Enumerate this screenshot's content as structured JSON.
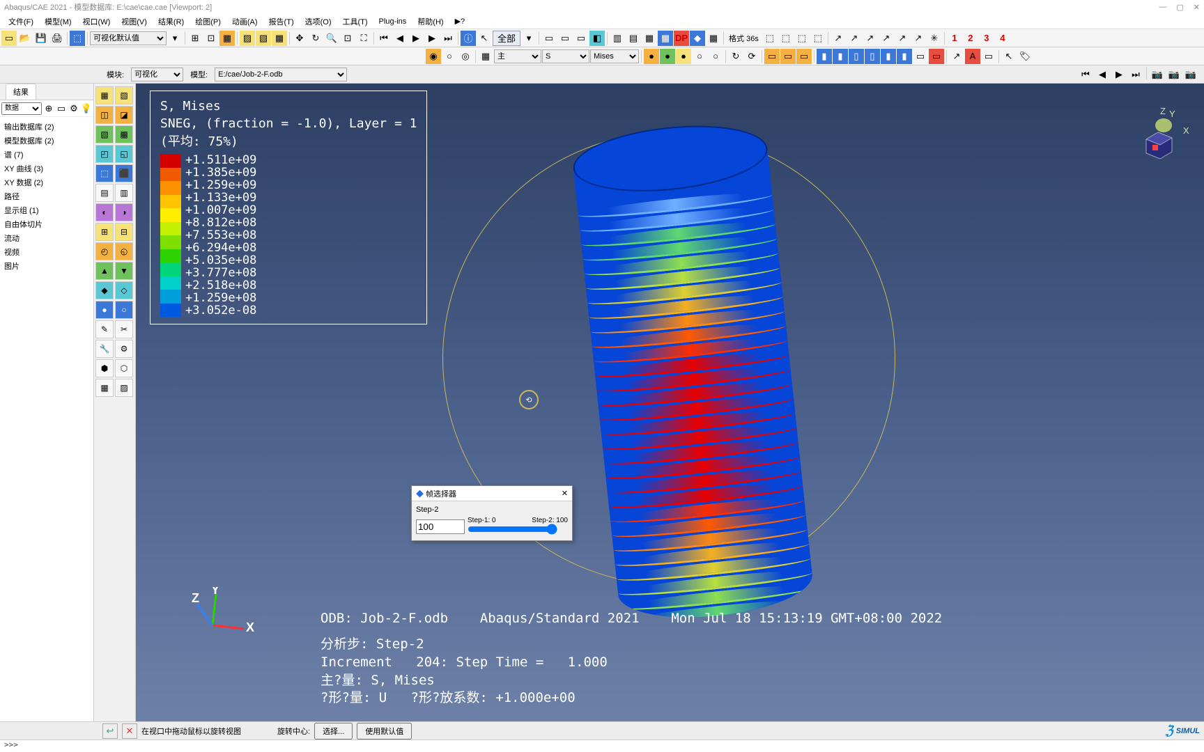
{
  "title": "Abaqus/CAE 2021 - 模型数据库: E:\\cae\\cae.cae [Viewport: 2]",
  "menu": [
    "文件(F)",
    "模型(M)",
    "视口(W)",
    "视图(V)",
    "结果(R)",
    "绘图(P)",
    "动画(A)",
    "报告(T)",
    "选项(O)",
    "工具(T)",
    "Plug-ins",
    "帮助(H)",
    "▶?"
  ],
  "toolbar1": {
    "viz_dropdown": "可视化默认值"
  },
  "toolbar_right": {
    "all_btn": "全部",
    "format_label": "格式  36s",
    "s_dropdown": "S",
    "mises_dropdown": "Mises",
    "primary_dropdown": "主"
  },
  "context": {
    "module_label": "模块:",
    "module_value": "可视化",
    "model_label": "模型:",
    "model_value": "E:/cae/Job-2-F.odb"
  },
  "left_tab": "结果",
  "tree_toolbar": {
    "dropdown": "数据"
  },
  "tree": [
    "输出数据库 (2)",
    "模型数据库 (2)",
    "谱 (7)",
    "XY 曲线 (3)",
    "XY 数据 (2)",
    "路径",
    "显示组 (1)",
    "自由体切片",
    "流动",
    "视频",
    "图片"
  ],
  "legend": {
    "title1": "S, Mises",
    "title2": "SNEG, (fraction = -1.0), Layer = 1",
    "title3": "(平均: 75%)",
    "values": [
      "+1.511e+09",
      "+1.385e+09",
      "+1.259e+09",
      "+1.133e+09",
      "+1.007e+09",
      "+8.812e+08",
      "+7.553e+08",
      "+6.294e+08",
      "+5.035e+08",
      "+3.777e+08",
      "+2.518e+08",
      "+1.259e+08",
      "+3.052e-08"
    ],
    "colors": [
      "#d40000",
      "#f25a00",
      "#ff9100",
      "#ffc400",
      "#ffee00",
      "#c3f000",
      "#7de000",
      "#2dd200",
      "#00d478",
      "#00d0c8",
      "#009edb",
      "#005ae0",
      "#002fd8"
    ]
  },
  "vp_info": {
    "line1": "ODB: Job-2-F.odb    Abaqus/Standard 2021    Mon Jul 18 15:13:19 GMT+08:00 2022",
    "line2": "分析步: Step-2",
    "line3": "Increment   204: Step Time =   1.000",
    "line4": "主?量: S, Mises",
    "line5": "?形?量: U   ?形?放系数: +1.000e+00"
  },
  "dialog": {
    "title": "帧选择器",
    "step": "Step-2",
    "lbl_left": "Step-1: 0",
    "lbl_right": "Step-2: 100",
    "value": "100",
    "close": "✕"
  },
  "action_bar": {
    "hint": "在视口中拖动鼠标以旋转视图",
    "rot_center": "旋转中心:",
    "select_btn": "选择...",
    "default_btn": "使用默认值",
    "logo": "SIMUL"
  },
  "cli": ">>>",
  "triad_labels": {
    "x": "X",
    "y": "Y",
    "z": "Z"
  }
}
